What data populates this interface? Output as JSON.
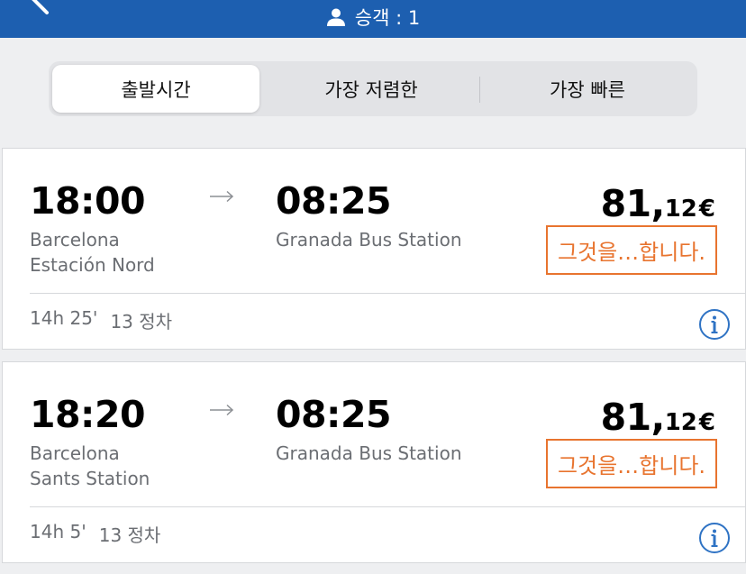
{
  "header": {
    "passengers_label": "승객 : 1"
  },
  "tabs": [
    {
      "label": "출발시간",
      "active": true
    },
    {
      "label": "가장 저렴한",
      "active": false
    },
    {
      "label": "가장 빠른",
      "active": false
    }
  ],
  "trips": [
    {
      "departure_time": "18:00",
      "departure_station_line1": "Barcelona",
      "departure_station_line2": "Estación Nord",
      "arrival_time": "08:25",
      "arrival_station": "Granada Bus Station",
      "price_euros": "81,",
      "price_cents": "12",
      "currency": "€",
      "badge": "그것을…합니다.",
      "duration": "14h 25'",
      "stops": "13 정차"
    },
    {
      "departure_time": "18:20",
      "departure_station_line1": "Barcelona",
      "departure_station_line2": "Sants Station",
      "arrival_time": "08:25",
      "arrival_station": "Granada Bus Station",
      "price_euros": "81,",
      "price_cents": "12",
      "currency": "€",
      "badge": "그것을…합니다.",
      "duration": "14h 5'",
      "stops": "13 정차"
    }
  ],
  "colors": {
    "header": "#1d5fb0",
    "badge": "#e8742f",
    "info_icon": "#2f73c4"
  }
}
